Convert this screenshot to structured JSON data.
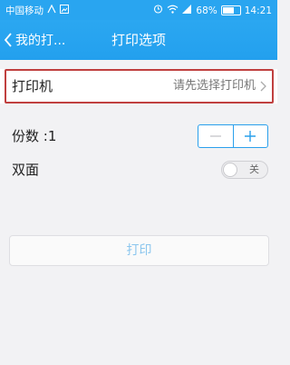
{
  "status_bar": {
    "carrier": "中国移动",
    "battery_percent": "68%",
    "battery_level": 0.68,
    "time": "14:21",
    "icons": [
      "signal-icon",
      "image-icon",
      "alarm-icon",
      "wifi-icon",
      "cellular-icon",
      "battery-icon"
    ]
  },
  "nav": {
    "back_label": "我的打...",
    "title": "打印选项"
  },
  "printer": {
    "label": "打印机",
    "value": "请先选择打印机"
  },
  "copies": {
    "label": "份数 :1"
  },
  "duplex": {
    "label": "双面",
    "toggle_text": "关"
  },
  "actions": {
    "print_label": "打印"
  },
  "colors": {
    "accent": "#29a5f0",
    "highlight_border": "#c0403f",
    "print_text": "#8bc6ee"
  }
}
